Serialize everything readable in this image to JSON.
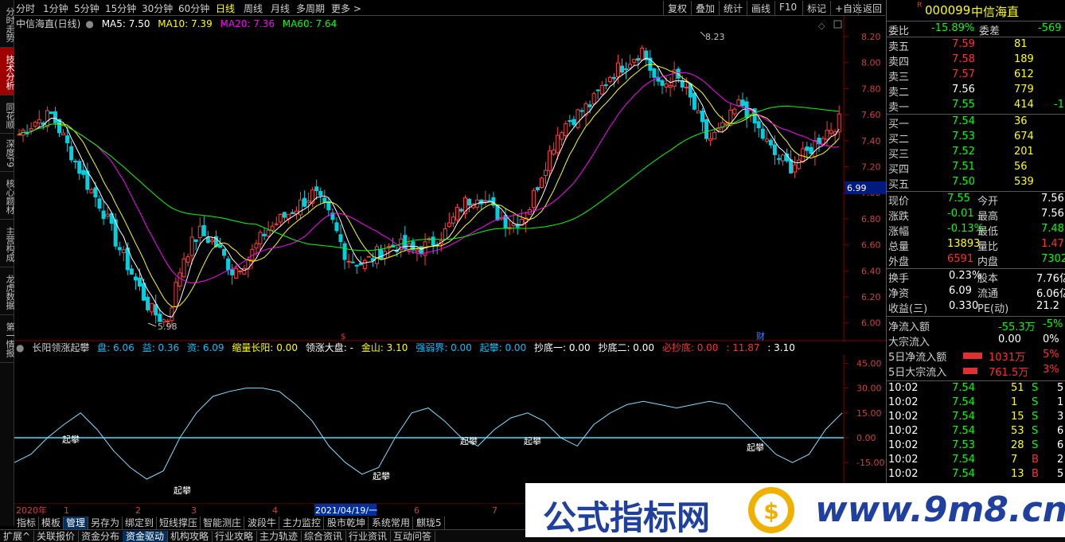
{
  "left_nav": [
    "分时走势",
    "技术分析",
    "同花顺",
    "深度F9",
    "核心题材",
    "主营构成",
    "龙虎数据",
    "第一情报"
  ],
  "top_tabs": [
    "分时",
    "1分钟",
    "5分钟",
    "15分钟",
    "30分钟",
    "60分钟",
    "日线",
    "周线",
    "月线",
    "多周期",
    "更多"
  ],
  "top_right_buttons": [
    "复权",
    "叠加",
    "统计",
    "画线",
    "F10",
    "标记",
    "+自选",
    "返回"
  ],
  "main_header": {
    "title": "中信海直(日线)",
    "ma5": "MA5: 7.50",
    "ma10": "MA10: 7.39",
    "ma20": "MA20: 7.36",
    "ma60": "MA60: 7.64"
  },
  "price_axis": [
    "8.20",
    "8.00",
    "7.80",
    "7.60",
    "7.40",
    "7.20",
    "7.00",
    "6.80",
    "6.60",
    "6.40",
    "6.20",
    "6.00"
  ],
  "price_marker": "6.99",
  "high_label": "8.23",
  "low_label": "5.98",
  "chart_tags": {
    "s_tag": "$",
    "cai_tag": "财"
  },
  "sub_header": {
    "name": "长阳领涨起攀",
    "pan": "盘: 6.06",
    "yi": "益: 0.36",
    "zi": "资: 6.09",
    "suoliang": "缩量长阳: 0.00",
    "lingzhang": "领涨大盘: -",
    "jinshan": "金山: 3.10",
    "qiangruo": "强弱界: 0.00",
    "qipan": "起攀: 0.00",
    "chaodi1": "抄底一: 0.00",
    "chaodi2": "抄底二: 0.00",
    "bichaodi": "必抄底: 0.00",
    "v1": ": 11.87",
    "v2": ": 3.10"
  },
  "sub_axis": [
    "45.00",
    "30.00",
    "15.00",
    "0.00",
    "-15.00"
  ],
  "qipan_labels": [
    "起攀",
    "起攀",
    "起攀",
    "起攀",
    "起攀",
    "起攀"
  ],
  "time_axis": [
    "2020年",
    "1",
    "2",
    "3",
    "4",
    "2021/04/19/一",
    "6",
    "7"
  ],
  "bottom_tabs": [
    "指标",
    "模板",
    "管理",
    "另存为",
    "绑定到",
    "短线撑压",
    "智能测庄",
    "波段牛",
    "主力监控",
    "股市乾坤",
    "系统常用",
    "麒珑5"
  ],
  "bottom_bar": [
    "扩展^",
    "关联报价",
    "资金分布",
    "资金驱动",
    "机构攻略",
    "行业攻略",
    "主力轨迹",
    "综合资讯",
    "行业资讯",
    "互动问答"
  ],
  "stock": {
    "code": "000099",
    "name": "中信海直",
    "flag": "R"
  },
  "weibi": {
    "label": "委比",
    "value": "-15.89%",
    "label2": "委差",
    "value2": "-569"
  },
  "asks": [
    {
      "label": "卖五",
      "price": "7.59",
      "vol": "81",
      "chg": ""
    },
    {
      "label": "卖四",
      "price": "7.58",
      "vol": "189",
      "chg": ""
    },
    {
      "label": "卖三",
      "price": "7.57",
      "vol": "612",
      "chg": ""
    },
    {
      "label": "卖二",
      "price": "7.56",
      "vol": "779",
      "chg": ""
    },
    {
      "label": "卖一",
      "price": "7.55",
      "vol": "414",
      "chg": "-1"
    }
  ],
  "bids": [
    {
      "label": "买一",
      "price": "7.54",
      "vol": "36"
    },
    {
      "label": "买二",
      "price": "7.53",
      "vol": "674"
    },
    {
      "label": "买三",
      "price": "7.52",
      "vol": "201"
    },
    {
      "label": "买四",
      "price": "7.51",
      "vol": "56"
    },
    {
      "label": "买五",
      "price": "7.50",
      "vol": "539"
    }
  ],
  "quote": [
    {
      "l1": "现价",
      "v1": "7.55",
      "l2": "今开",
      "v2": "7.56"
    },
    {
      "l1": "涨跌",
      "v1": "-0.01",
      "l2": "最高",
      "v2": "7.56"
    },
    {
      "l1": "涨幅",
      "v1": "-0.13%",
      "l2": "最低",
      "v2": "7.48"
    },
    {
      "l1": "总量",
      "v1": "13893",
      "l2": "量比",
      "v2": "1.47"
    },
    {
      "l1": "外盘",
      "v1": "6591",
      "l2": "内盘",
      "v2": "7302"
    }
  ],
  "fund": [
    {
      "l1": "换手",
      "v1": "0.23%",
      "l2": "股本",
      "v2": "7.76亿"
    },
    {
      "l1": "净资",
      "v1": "6.09",
      "l2": "流通",
      "v2": "6.06亿"
    },
    {
      "l1": "收益(三)",
      "v1": "0.330",
      "l2": "PE(动)",
      "v2": "21.2"
    }
  ],
  "flow": [
    {
      "label": "净流入额",
      "value": "-55.3万",
      "pct": "-5%"
    },
    {
      "label": "大宗流入",
      "value": "0.00",
      "pct": "0%"
    },
    {
      "label": "5日净流入额",
      "value": "1031万",
      "pct": "5%"
    },
    {
      "label": "5日大宗流入",
      "value": "761.5万",
      "pct": "3%"
    }
  ],
  "ticks": [
    {
      "time": "10:02",
      "price": "7.54",
      "vol": "51",
      "side": "S",
      "n": "5"
    },
    {
      "time": "10:02",
      "price": "7.54",
      "vol": "1",
      "side": "S",
      "n": "1"
    },
    {
      "time": "10:02",
      "price": "7.54",
      "vol": "15",
      "side": "S",
      "n": "3"
    },
    {
      "time": "10:02",
      "price": "7.54",
      "vol": "53",
      "side": "S",
      "n": "6"
    },
    {
      "time": "10:02",
      "price": "7.53",
      "vol": "28",
      "side": "S",
      "n": "6"
    },
    {
      "time": "10:02",
      "price": "7.54",
      "vol": "7",
      "side": "B",
      "n": "2"
    },
    {
      "time": "10:02",
      "price": "7.54",
      "vol": "13",
      "side": "B",
      "n": "5"
    }
  ],
  "watermark": {
    "text": "公式指标网",
    "url": "www.9m8.cn"
  },
  "colors": {
    "up": "#ff4040",
    "down": "#00c0c0",
    "ma5": "#ffffff",
    "ma10": "#ffff00",
    "ma20": "#ff00ff",
    "ma60": "#00ff00",
    "yellow": "#ffff00",
    "blue_text": "#4080ff"
  }
}
